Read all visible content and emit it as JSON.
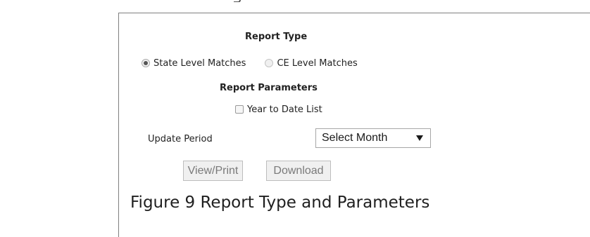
{
  "form": {
    "report_type_heading": "Report Type",
    "report_type_options": [
      {
        "label": "State Level Matches",
        "selected": true
      },
      {
        "label": "CE Level Matches",
        "selected": false
      }
    ],
    "report_parameters_heading": "Report Parameters",
    "year_to_date": {
      "label": "Year to Date List",
      "checked": false
    },
    "update_period": {
      "label": "Update Period",
      "selected_value": "Select Month"
    },
    "buttons": {
      "view_print": "View/Print",
      "download": "Download"
    }
  },
  "caption": "Figure 9 Report Type and Parameters",
  "icons": {
    "select_caret": "triangle-down-icon"
  }
}
